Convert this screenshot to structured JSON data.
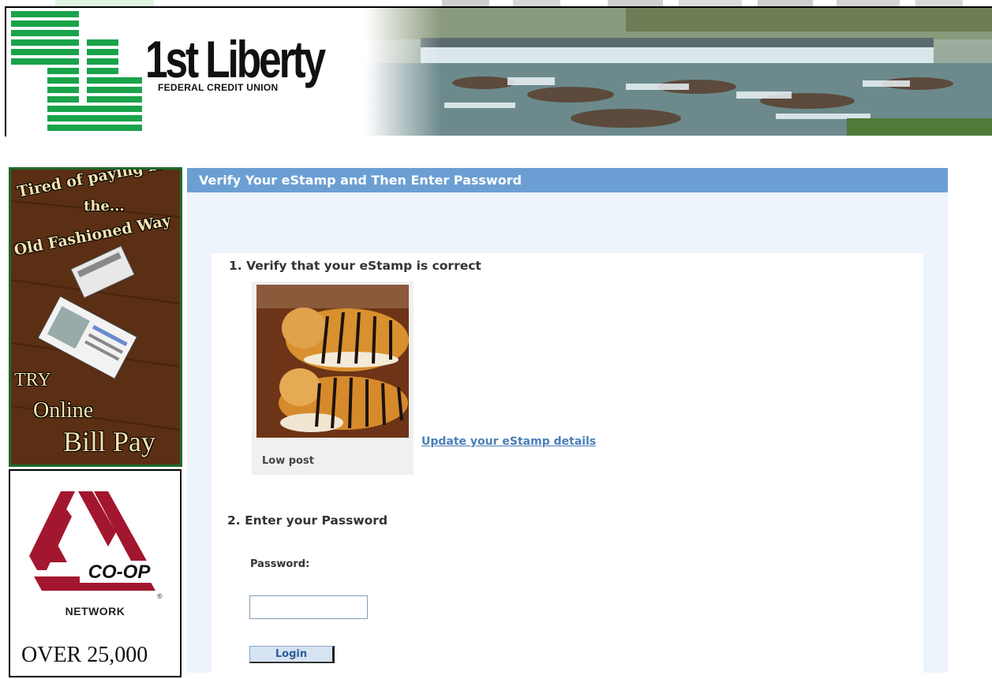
{
  "header": {
    "brand_name": "1st Liberty",
    "brand_sub": "FEDERAL CREDIT UNION"
  },
  "ads": {
    "bill_pay": {
      "line1": "Tired of paying bills",
      "line2": "the...",
      "line3": "Old Fashioned Way",
      "line4": "TRY",
      "line5": "Online",
      "line6": "Bill Pay"
    },
    "coop": {
      "logo_text": "CO-OP",
      "network": "NETWORK",
      "reg_mark": "®",
      "over": "OVER 25,000"
    }
  },
  "panel": {
    "title": "Verify Your eStamp and Then Enter Password",
    "step1_title": "1. Verify that your eStamp is correct",
    "estamp_caption": "Low post",
    "update_link": "Update your eStamp details",
    "step2_title": "2. Enter your Password",
    "password_label": "Password:",
    "password_value": "",
    "login_label": "Login"
  },
  "colors": {
    "header_bar": "#6b9fd3",
    "panel_bg": "#eef4fb",
    "link": "#4a7fb8",
    "logo_green": "#1aa34a",
    "coop_red": "#a3162f"
  },
  "icons": {
    "logo": "green-striped-l-logo",
    "coop_logo": "coop-triangle-logo"
  }
}
